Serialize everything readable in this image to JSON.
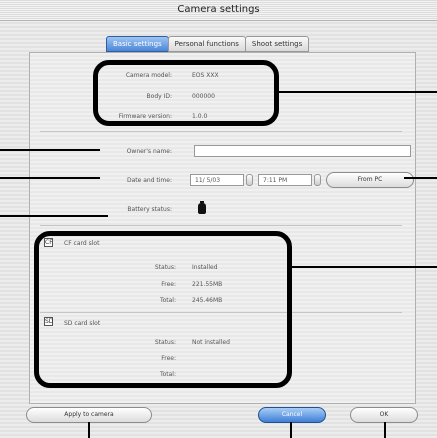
{
  "window": {
    "title": "Camera settings"
  },
  "tabs": [
    {
      "label": "Basic settings",
      "active": true
    },
    {
      "label": "Personal functions",
      "active": false
    },
    {
      "label": "Shoot settings",
      "active": false
    }
  ],
  "camera_info": {
    "model_label": "Camera model:",
    "model_value": "EOS XXX",
    "body_id_label": "Body ID:",
    "body_id_value": "000000",
    "firmware_label": "Firmware version:",
    "firmware_value": "1.0.0"
  },
  "owner": {
    "label": "Owner's name:",
    "value": ""
  },
  "datetime": {
    "label": "Date and time:",
    "date_value": "11/ 5/03",
    "time_value": "7:11 PM",
    "from_pc_label": "From PC"
  },
  "battery": {
    "label": "Battery status:",
    "icon": "battery-icon"
  },
  "cf_card": {
    "title": "CF card slot",
    "status_label": "Status:",
    "status_value": "Installed",
    "free_label": "Free:",
    "free_value": "221.55MB",
    "total_label": "Total:",
    "total_value": "245.46MB"
  },
  "sd_card": {
    "title": "SD card slot",
    "status_label": "Status:",
    "status_value": "Not installed",
    "free_label": "Free:",
    "free_value": "",
    "total_label": "Total:",
    "total_value": ""
  },
  "buttons": {
    "apply": "Apply to camera",
    "cancel": "Cancel",
    "ok": "OK"
  },
  "colors": {
    "accent": "#4a86d8",
    "callout": "#000000"
  }
}
